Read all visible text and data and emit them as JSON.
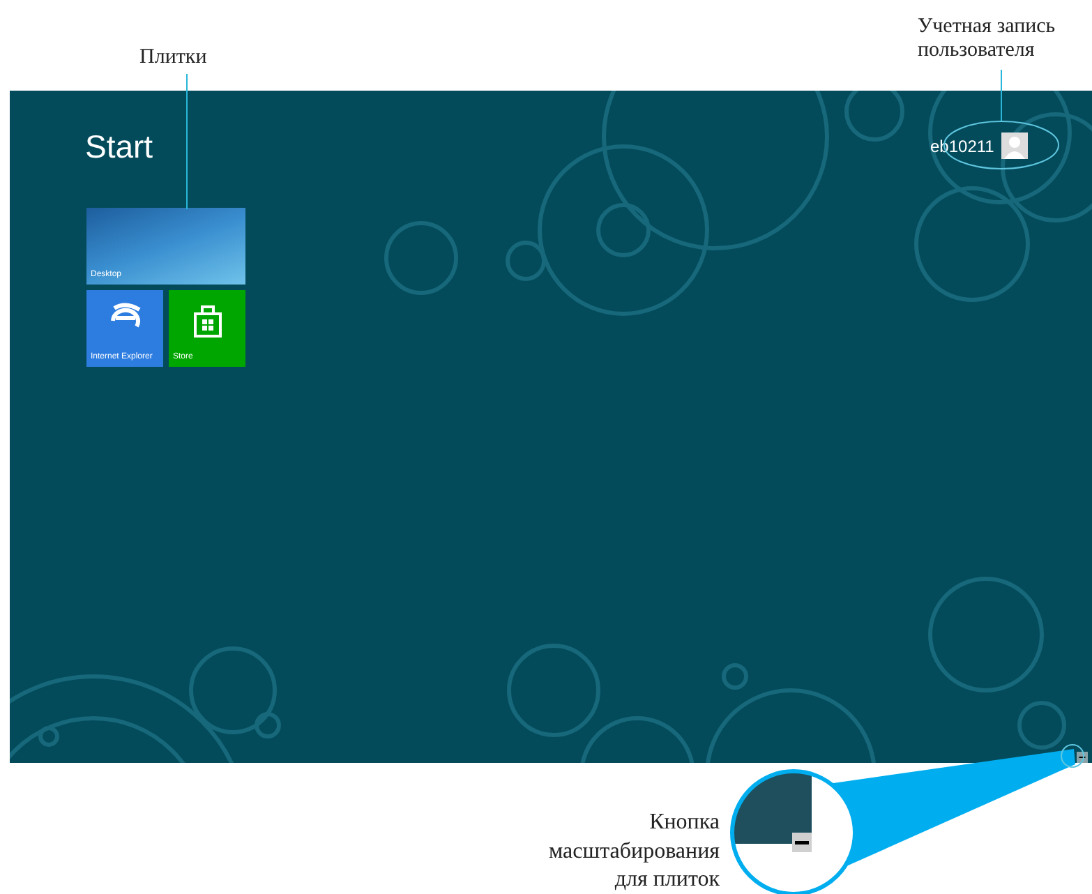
{
  "annotations": [
    {
      "kind": "tiles",
      "text": "Плитки"
    },
    {
      "kind": "account",
      "lines": [
        "Учетная запись",
        "пользователя"
      ]
    },
    {
      "kind": "zoom",
      "lines": [
        "Кнопка",
        "масштабирования",
        "для плиток"
      ]
    }
  ],
  "screen": {
    "title": "Start",
    "user": {
      "name": "eb10211"
    },
    "tiles": [
      {
        "kind": "desktop",
        "label": "Desktop"
      },
      {
        "kind": "browser",
        "label": "Internet Explorer"
      },
      {
        "kind": "store",
        "label": "Store"
      }
    ],
    "zoom_button": {
      "glyph": "−"
    }
  }
}
